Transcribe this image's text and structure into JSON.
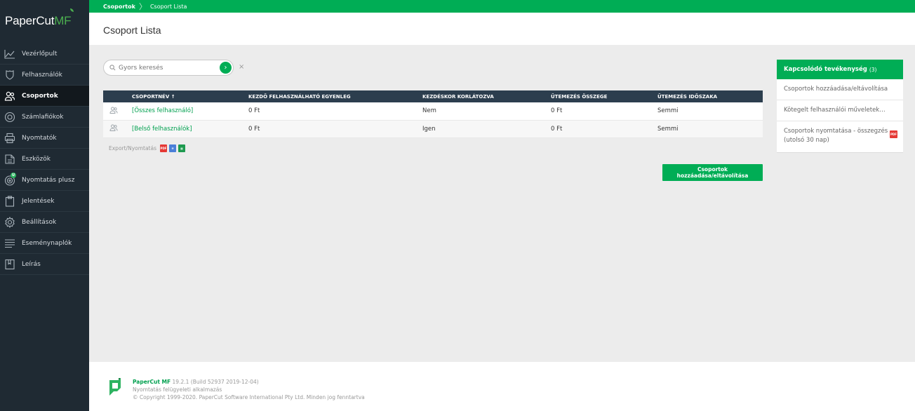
{
  "app": {
    "logo_main": "PaperCut",
    "logo_suffix": "MF"
  },
  "breadcrumb": {
    "root": "Csoportok",
    "current": "Csoport Lista"
  },
  "page_title": "Csoport Lista",
  "sidebar": {
    "items": [
      {
        "label": "Vezérlőpult",
        "icon": "chart-line-icon"
      },
      {
        "label": "Felhasználók",
        "icon": "shield-icon"
      },
      {
        "label": "Csoportok",
        "icon": "users-icon",
        "active": true
      },
      {
        "label": "Számlafiókok",
        "icon": "coin-icon"
      },
      {
        "label": "Nyomtatók",
        "icon": "printer-icon"
      },
      {
        "label": "Eszközök",
        "icon": "device-icon"
      },
      {
        "label": "Nyomtatás plusz",
        "icon": "target-icon",
        "badge": "U"
      },
      {
        "label": "Jelentések",
        "icon": "clipboard-icon"
      },
      {
        "label": "Beállítások",
        "icon": "gear-icon"
      },
      {
        "label": "Eseménynaplók",
        "icon": "list-icon"
      },
      {
        "label": "Leírás",
        "icon": "book-icon"
      }
    ]
  },
  "search": {
    "placeholder": "Gyors keresés",
    "go_label": "›",
    "clear_label": "×"
  },
  "table": {
    "headers": [
      "CSOPORTNÉV",
      "KEZDŐ FELHASZNÁLHATÓ EGYENLEG",
      "KEZDÉSKOR KORLÁTOZVA",
      "ÜTEMEZÉS ÖSSZEGE",
      "ÜTEMEZÉS IDŐSZAKA"
    ],
    "sort_indicator": "↑",
    "rows": [
      {
        "name": "[Összes felhasználó]",
        "balance": "0 Ft",
        "restricted": "Nem",
        "schedule_amount": "0 Ft",
        "schedule_period": "Semmi"
      },
      {
        "name": "[Belső felhasználók]",
        "balance": "0 Ft",
        "restricted": "Igen",
        "schedule_amount": "0 Ft",
        "schedule_period": "Semmi"
      }
    ]
  },
  "export": {
    "label": "Export/Nyomtatás",
    "pdf": "PDF",
    "doc": "≡",
    "xls": "▦"
  },
  "add_button": "Csoportok hozzáadása/eltávolítása",
  "related": {
    "title": "Kapcsolódó tevékenység",
    "count": "(3)",
    "items": [
      "Csoportok hozzáadása/eltávolítása",
      "Kötegelt felhasználói műveletek…",
      "Csoportok nyomtatása - összegzés (utolsó 30 nap)"
    ],
    "pdf_badge": "PDF"
  },
  "footer": {
    "brand": "PaperCut MF",
    "version": "19.2.1 (Build 52937 2019-12-04)",
    "subtitle": "Nyomtatás felügyeleti alkalmazás",
    "copyright": "© Copyright 1999-2020. PaperCut Software International Pty Ltd. Minden jog fenntartva"
  },
  "colors": {
    "brand_green": "#00ad55",
    "sidebar_bg": "#1f2a33",
    "table_header_bg": "#2c3e4e"
  }
}
